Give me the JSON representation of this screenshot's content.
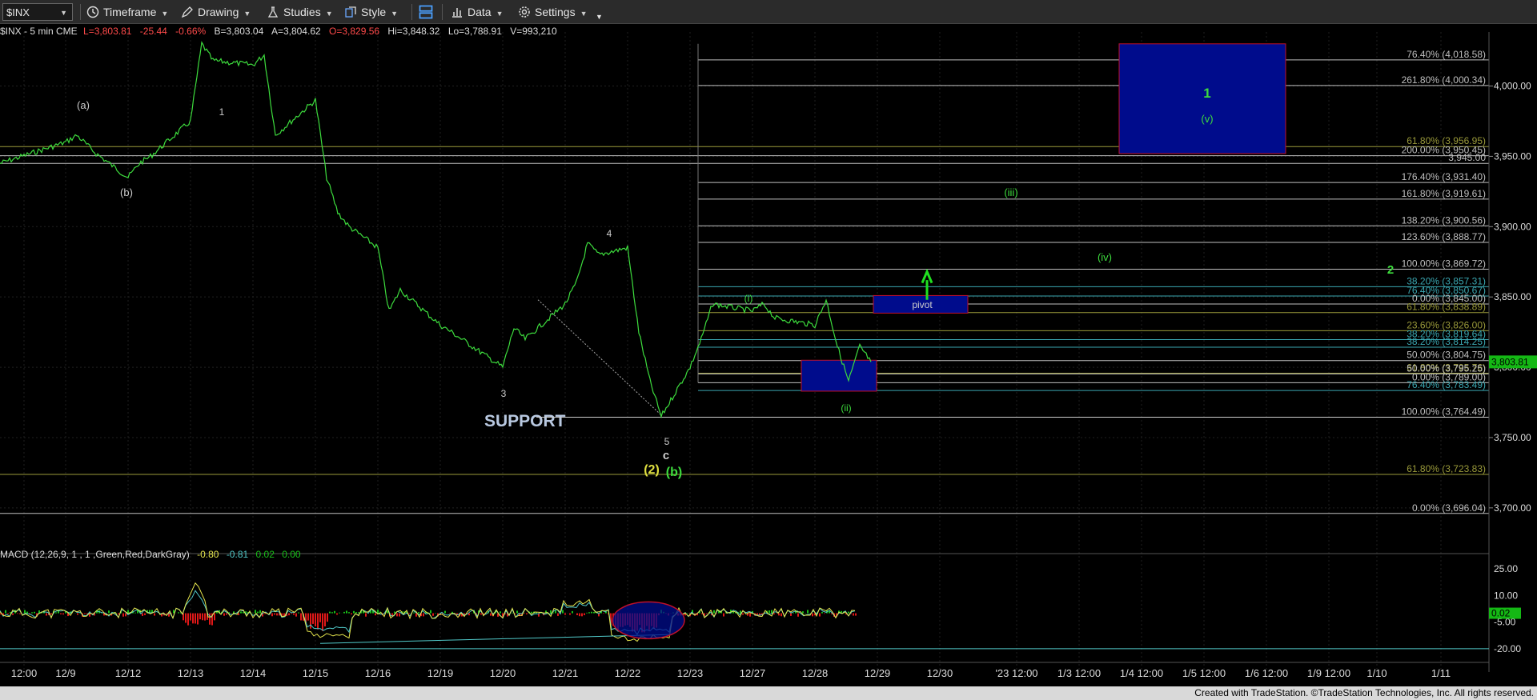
{
  "toolbar": {
    "symbol": "$INX",
    "timeframe": "Timeframe",
    "drawing": "Drawing",
    "studies": "Studies",
    "style": "Style",
    "data": "Data",
    "settings": "Settings"
  },
  "info": {
    "symbol_line": "$INX - 5 min  CME",
    "low": "L=3,803.81",
    "change": "-25.44",
    "change_pct": "-0.66%",
    "bid": "B=3,803.04",
    "ask": "A=3,804.62",
    "open": "O=3,829.56",
    "hi": "Hi=3,848.32",
    "lo": "Lo=3,788.91",
    "volume": "V=993,210"
  },
  "macd": {
    "label": "MACD (12,26,9, 1 , 1 ,Green,Red,DarkGray)",
    "v1": "-0.80",
    "v2": "-0.81",
    "v3": "0.02",
    "v4": "0.00"
  },
  "colors": {
    "price": "#3ddc3d",
    "fib_white": "#bfbfbf",
    "fib_yellow": "#9a9a3a",
    "fib_cyan": "#3aa6b0",
    "box_fill": "#000c8c",
    "box_border": "#c0102a",
    "macd_line": "#e6e64d",
    "signal": "#50c8c8",
    "hist_pos": "#18c018",
    "hist_neg": "#e01818"
  },
  "footer": "Created with TradeStation. ©TradeStation Technologies, Inc. All rights reserved.",
  "chart_data": {
    "type": "line",
    "title": "$INX - 5 min",
    "ylim": [
      3680,
      4035
    ],
    "current_price": "3,803.81",
    "y_ticks": [
      "4,000.00",
      "3,950.00",
      "3,900.00",
      "3,850.00",
      "3,800.00",
      "3,750.00",
      "3,700.00"
    ],
    "x_labels": [
      "12:00",
      "12/9",
      "12/12",
      "12/13",
      "12/14",
      "12/15",
      "12/16",
      "12/19",
      "12/20",
      "12/21",
      "12/22",
      "12/23",
      "12/27",
      "12/28",
      "12/29",
      "12/30",
      "'23 12:00",
      "1/3 12:00",
      "1/4 12:00",
      "1/5 12:00",
      "1/6 12:00",
      "1/9 12:00",
      "1/10",
      "1/11"
    ],
    "series": [
      {
        "x": [
          "12/8 12:00",
          "12/9",
          "12/9",
          "12/10",
          "12/12",
          "12/12",
          "12/12",
          "12/13",
          "12/13",
          "12/13",
          "12/14",
          "12/14",
          "12/14",
          "12/15",
          "12/15",
          "12/15",
          "12/15",
          "12/16",
          "12/16",
          "12/16",
          "12/19",
          "12/19",
          "12/20",
          "12/20",
          "12/20",
          "12/21",
          "12/21",
          "12/21",
          "12/21",
          "12/22",
          "12/22",
          "12/22",
          "12/22",
          "12/23",
          "12/23",
          "12/23",
          "12/27",
          "12/27",
          "12/27",
          "12/28",
          "12/28",
          "12/28",
          "12/28",
          "12/28",
          "12/28"
        ],
        "values": [
          3945,
          3960,
          3965,
          3952,
          3935,
          3945,
          3950,
          3975,
          4030,
          4018,
          4015,
          4022,
          3965,
          3990,
          3935,
          3910,
          3900,
          3885,
          3840,
          3855,
          3830,
          3825,
          3800,
          3828,
          3820,
          3845,
          3860,
          3888,
          3880,
          3885,
          3825,
          3790,
          3765,
          3800,
          3820,
          3845,
          3840,
          3845,
          3835,
          3830,
          3848,
          3815,
          3790,
          3815,
          3803.81
        ]
      }
    ],
    "fib_levels": [
      {
        "label": "76.40% (4,018.58)",
        "value": 4018.58
      },
      {
        "label": "261.80% (4,000.34)",
        "value": 4000.34
      },
      {
        "label": "61.80% (3,956.95)",
        "value": 3956.95
      },
      {
        "label": "200.00% (3,950.45)",
        "value": 3950.45
      },
      {
        "label": "3,945.00",
        "value": 3945
      },
      {
        "label": "176.40% (3,931.40)",
        "value": 3931.4
      },
      {
        "label": "161.80% (3,919.61)",
        "value": 3919.61
      },
      {
        "label": "138.20% (3,900.56)",
        "value": 3900.56
      },
      {
        "label": "123.60% (3,888.77)",
        "value": 3888.77
      },
      {
        "label": "100.00% (3,869.72)",
        "value": 3869.72
      },
      {
        "label": "38.20% (3,857.31)",
        "value": 3857.31
      },
      {
        "label": "76.40% (3,850.67)",
        "value": 3850.67
      },
      {
        "label": "0.00% (3,845.00)",
        "value": 3845
      },
      {
        "label": "61.80% (3,838.89)",
        "value": 3838.89
      },
      {
        "label": "23.60% (3,826.00)",
        "value": 3826
      },
      {
        "label": "38.20% (3,819.64)",
        "value": 3819.64
      },
      {
        "label": "38.20% (3,814.25)",
        "value": 3814.25
      },
      {
        "label": "50.00% (3,804.75)",
        "value": 3804.75
      },
      {
        "label": "61.80% (3,795.76)",
        "value": 3795.76
      },
      {
        "label": "50.00% (3,795.25)",
        "value": 3795.25
      },
      {
        "label": "0.00% (3,789.00)",
        "value": 3789
      },
      {
        "label": "76.40% (3,783.49)",
        "value": 3783.49
      },
      {
        "label": "100.00% (3,764.49)",
        "value": 3764.49
      },
      {
        "label": "61.80% (3,723.83)",
        "value": 3723.83
      },
      {
        "label": "0.00% (3,696.04)",
        "value": 3696.04
      }
    ],
    "wave_labels": [
      {
        "text": "(a)",
        "x": "12/9",
        "y": 3975
      },
      {
        "text": "(b)",
        "x": "12/12",
        "y": 3935
      },
      {
        "text": "1",
        "x": "12/13",
        "y": 4018
      },
      {
        "text": "3",
        "x": "12/20",
        "y": 3800
      },
      {
        "text": "4",
        "x": "12/21",
        "y": 3888
      },
      {
        "text": "5",
        "x": "12/22",
        "y": 3765
      },
      {
        "text": "c",
        "x": "12/22",
        "y": 3765
      },
      {
        "text": "(2)",
        "x": "12/22",
        "y": 3765
      },
      {
        "text": "(b)",
        "x": "12/22",
        "y": 3765
      },
      {
        "text": "(i)",
        "x": "12/27",
        "y": 3845
      },
      {
        "text": "(ii)",
        "x": "12/28",
        "y": 3790
      },
      {
        "text": "(iii)",
        "x": "'23 12:00",
        "y": 3919.61
      },
      {
        "text": "(iv)",
        "x": "1/3 12:00",
        "y": 3880
      },
      {
        "text": "(v)",
        "x": "1/4 12:00",
        "y": 3970
      },
      {
        "text": "1",
        "x": "1/4 12:00",
        "y": 3990
      },
      {
        "text": "2",
        "x": "1/9 12:00",
        "y": 3869.72
      }
    ],
    "annotations": [
      "SUPPORT",
      "pivot"
    ],
    "macd_y_ticks": [
      "25.00",
      "10.00",
      "-5.00",
      "-20.00"
    ],
    "macd_current": "0.02"
  }
}
